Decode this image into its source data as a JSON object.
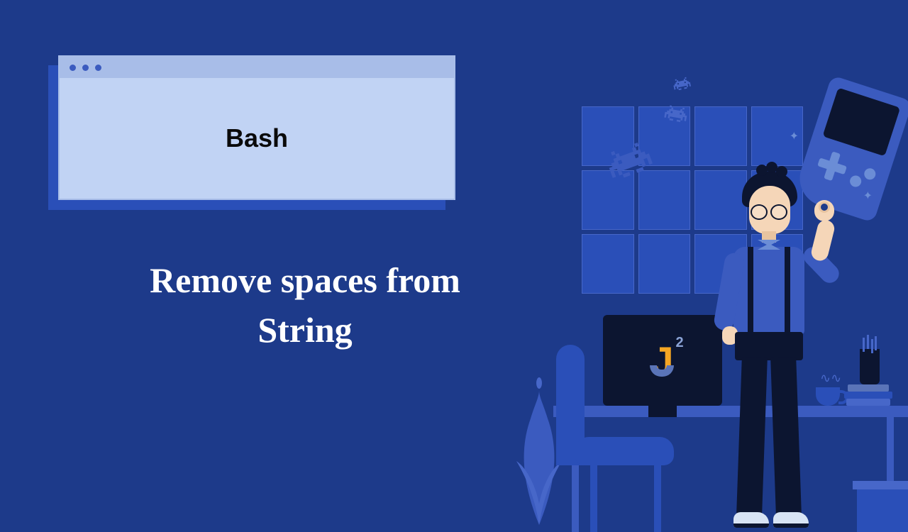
{
  "window": {
    "title": "Bash"
  },
  "subtitle": "Remove spaces from String",
  "monitor": {
    "logo_letter": "J",
    "logo_sup": "2"
  },
  "icons": {
    "invader": "space-invader-icon",
    "sparkle": "sparkle-icon",
    "gameboy": "gameboy-icon",
    "plant": "plant-icon",
    "cup": "coffee-cup-icon"
  }
}
